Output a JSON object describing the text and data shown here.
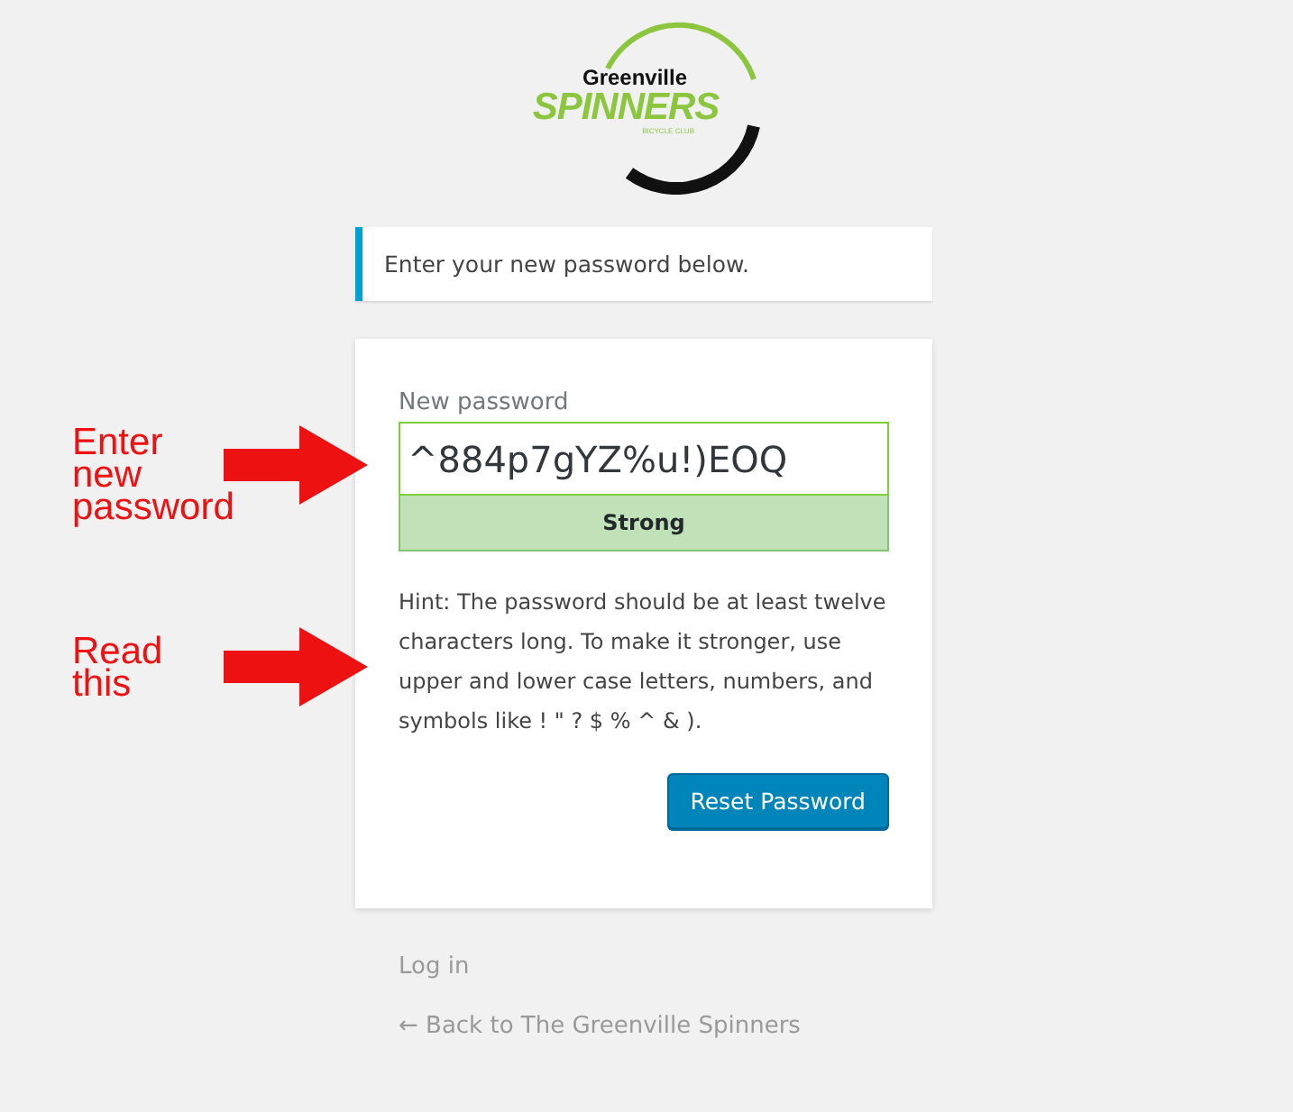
{
  "logo": {
    "line_1": "Greenville",
    "line_2": "SPINNERS",
    "line_3": "BICYCLE CLUB"
  },
  "message": "Enter your new password below.",
  "form": {
    "label": "New password",
    "value": "^884p7gYZ%u!)EOQ",
    "strength": {
      "kind": "strong",
      "label": "Strong"
    },
    "hint": "Hint: The password should be at least twelve characters long. To make it stronger, use upper and lower case letters, numbers, and symbols like ! \" ? $ % ^ & ).",
    "button": "Reset Password"
  },
  "links": [
    "Log in",
    "← Back to The Greenville Spinners"
  ],
  "annotations": [
    {
      "lines": [
        "Enter",
        "new",
        "password"
      ]
    },
    {
      "lines": [
        "Read",
        "this"
      ]
    }
  ]
}
